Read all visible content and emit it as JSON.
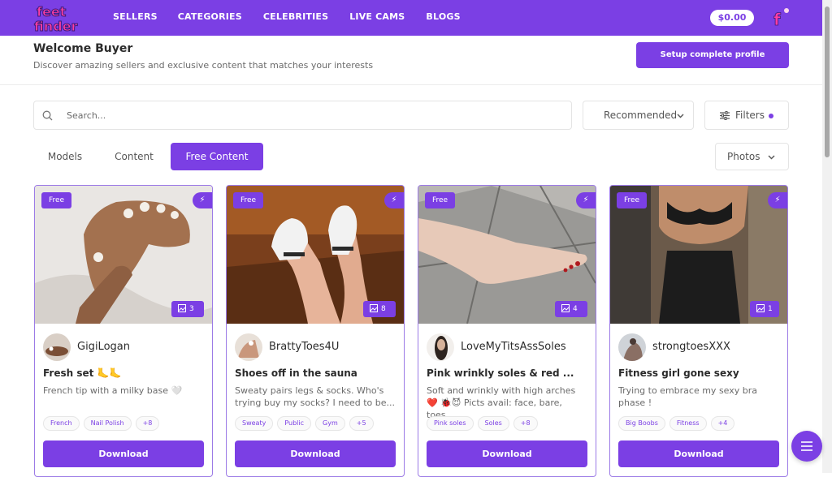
{
  "header": {
    "logo_line1": "feet",
    "logo_line2": "finder",
    "nav": [
      "SELLERS",
      "CATEGORIES",
      "CELEBRITIES",
      "LIVE CAMS",
      "BLOGS"
    ],
    "balance": "$0.00",
    "profile_letter": "f"
  },
  "welcome": {
    "title": "Welcome Buyer",
    "subtitle": "Discover amazing sellers and exclusive content that matches your interests",
    "setup_button": "Setup complete profile"
  },
  "search": {
    "placeholder": "Search..."
  },
  "sort": {
    "selected": "Recommended"
  },
  "filters": {
    "label": "Filters"
  },
  "tabs": [
    "Models",
    "Content",
    "Free Content"
  ],
  "media_select": {
    "selected": "Photos"
  },
  "cards": [
    {
      "badge": "Free",
      "count": "3",
      "username": "GigiLogan",
      "title": "Fresh set 🦶🦶",
      "description": "French tip with a milky base 🤍",
      "tags": [
        "French",
        "Nail Polish",
        "+8"
      ],
      "button": "Download"
    },
    {
      "badge": "Free",
      "count": "8",
      "username": "BrattyToes4U",
      "title": "Shoes off in the sauna",
      "description": "Sweaty pairs legs & socks. Who's trying buy my socks? I need to be...",
      "tags": [
        "Sweaty",
        "Public",
        "Gym",
        "+5"
      ],
      "button": "Download"
    },
    {
      "badge": "Free",
      "count": "4",
      "username": "LoveMyTitsAssSoles",
      "title": "Pink wrinkly soles & red ...",
      "description": "Soft and wrinkly with high arches ❤️ 🐞😈 Picts avail: face, bare, toes,...",
      "tags": [
        "Pink soles",
        "Soles",
        "+8"
      ],
      "button": "Download"
    },
    {
      "badge": "Free",
      "count": "1",
      "username": "strongtoesXXX",
      "title": "Fitness girl gone sexy",
      "description": "Trying to embrace my sexy bra phase !",
      "tags": [
        "Big Boobs",
        "Fitness",
        "+4"
      ],
      "button": "Download"
    }
  ],
  "colors": {
    "accent": "#7b3fe4",
    "logo_pink": "#ff3ea5"
  }
}
